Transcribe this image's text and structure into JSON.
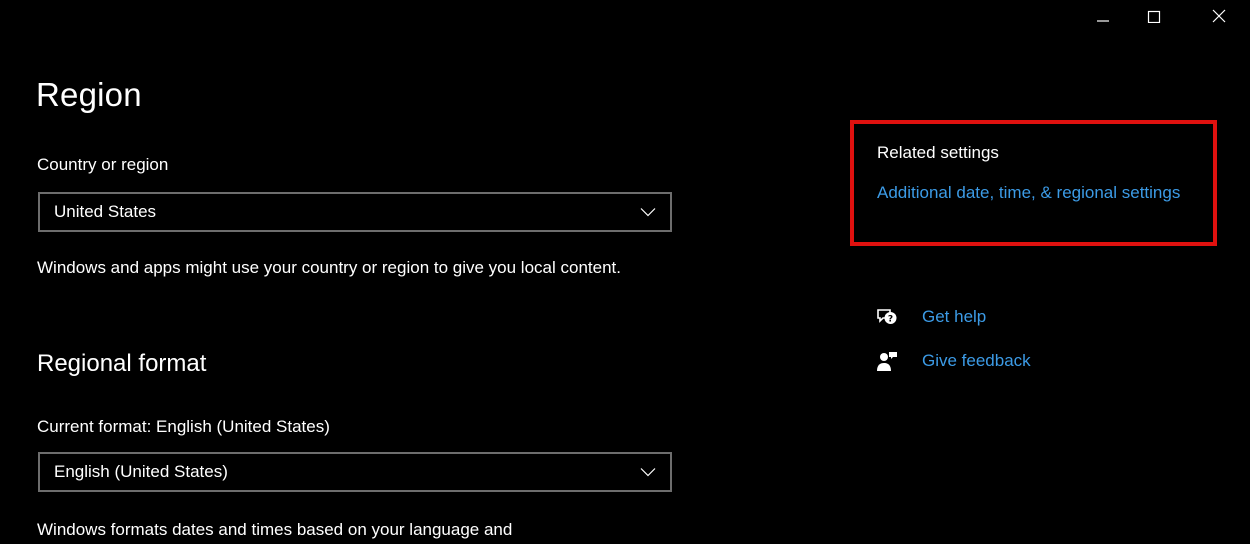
{
  "window": {
    "caption_buttons": [
      "minimize",
      "maximize",
      "close"
    ]
  },
  "page": {
    "title": "Region"
  },
  "country": {
    "label": "Country or region",
    "value": "United States",
    "description": "Windows and apps might use your country or region to give you local content."
  },
  "regional_format": {
    "heading": "Regional format",
    "label": "Current format: English (United States)",
    "value": "English (United States)",
    "description": "Windows formats dates and times based on your language and"
  },
  "related": {
    "heading": "Related settings",
    "link": "Additional date, time, & regional settings",
    "highlight_color": "#e0110f"
  },
  "help": {
    "get_help": "Get help",
    "get_help_icon": "help-chat-icon",
    "give_feedback": "Give feedback",
    "give_feedback_icon": "feedback-person-icon"
  },
  "colors": {
    "background": "#000000",
    "text": "#ffffff",
    "link": "#3c9be6",
    "dropdown_border": "#6d6d6d"
  }
}
